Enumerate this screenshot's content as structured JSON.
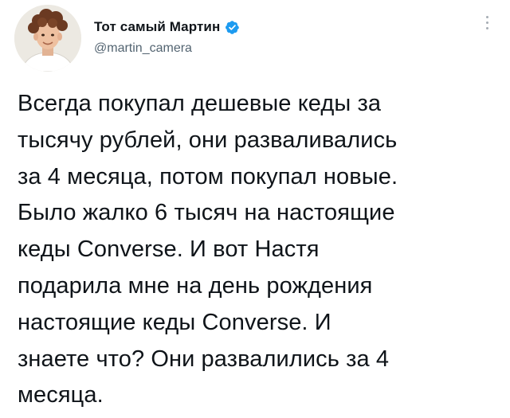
{
  "author": {
    "display_name": "Тот самый Мартин",
    "handle": "@martin_camera",
    "verified": true
  },
  "colors": {
    "verified_badge": "#1d9bf0",
    "handle": "#536471",
    "text": "#0f1419"
  },
  "icons": {
    "verified": "verified-badge-icon",
    "more": "more-vertical-icon"
  },
  "tweet": {
    "lines": [
      "Всегда покупал дешевые кеды за",
      "тысячу рублей, они разваливались",
      "за 4 месяца, потом покупал новые.",
      "Было жалко 6 тысяч на настоящие",
      "кеды Converse. И вот Настя",
      "подарила мне на день рождения",
      "настоящие кеды Converse. И",
      "знаете что? Они развалились за 4",
      "месяца."
    ]
  }
}
